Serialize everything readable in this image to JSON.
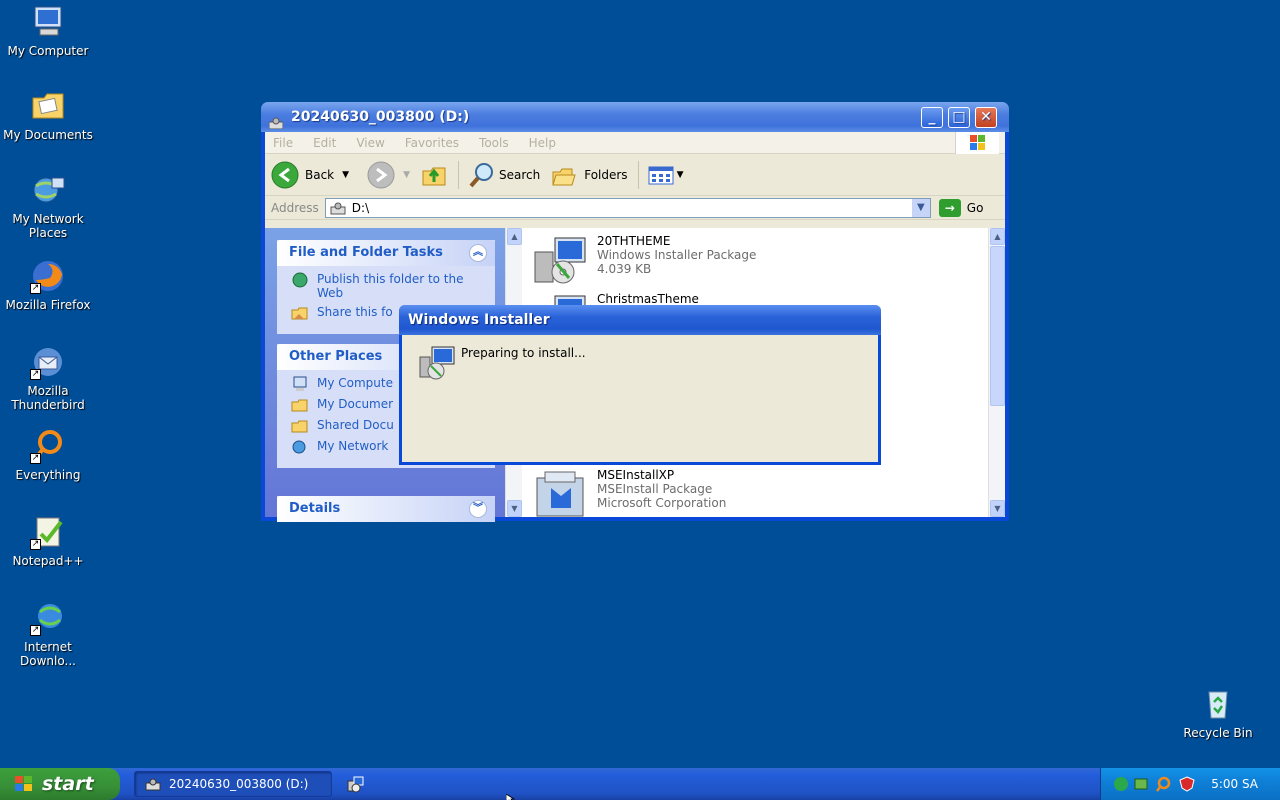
{
  "desktop": {
    "icons": [
      {
        "label": "My Computer"
      },
      {
        "label": "My Documents"
      },
      {
        "label": "My Network Places"
      },
      {
        "label": "Mozilla Firefox"
      },
      {
        "label": "Mozilla Thunderbird"
      },
      {
        "label": "Everything"
      },
      {
        "label": "Notepad++"
      },
      {
        "label": "Internet Downlo..."
      },
      {
        "label": "Recycle Bin"
      }
    ]
  },
  "explorer": {
    "title": "20240630_003800 (D:)",
    "menu": [
      "File",
      "Edit",
      "View",
      "Favorites",
      "Tools",
      "Help"
    ],
    "toolbar": {
      "back": "Back",
      "search": "Search",
      "folders": "Folders"
    },
    "address": {
      "label": "Address",
      "value": "D:\\",
      "go": "Go"
    },
    "tasks_panel": {
      "title": "File and Folder Tasks",
      "items": [
        "Publish this folder to the Web",
        "Share this fo"
      ]
    },
    "other_places": {
      "title": "Other Places",
      "items": [
        "My Compute",
        "My Documer",
        "Shared Docu",
        "My Network"
      ]
    },
    "details": {
      "title": "Details"
    },
    "files": [
      {
        "name": "20THTHEME",
        "type": "Windows Installer Package",
        "info": "4.039 KB"
      },
      {
        "name": "ChristmasTheme",
        "type": "",
        "info": ""
      },
      {
        "name": "MSEInstallXP",
        "type": "MSEInstall Package",
        "info": "Microsoft Corporation"
      }
    ]
  },
  "dialog": {
    "title": "Windows Installer",
    "message": "Preparing to install..."
  },
  "taskbar": {
    "start": "start",
    "task_title": "20240630_003800 (D:)",
    "clock": "5:00 SA"
  },
  "colors": {
    "desktop": "#004e98",
    "title_blue": "#0a48d8",
    "panel_link": "#215dc6",
    "start_green": "#378f37"
  }
}
